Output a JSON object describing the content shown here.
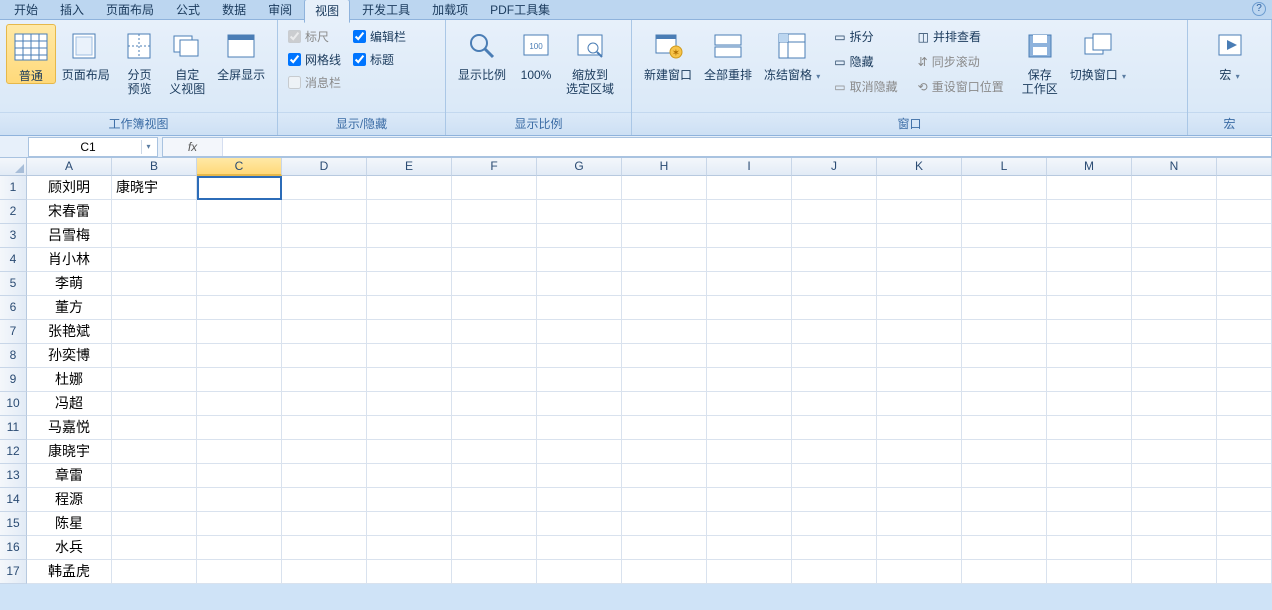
{
  "tabs": {
    "items": [
      "开始",
      "插入",
      "页面布局",
      "公式",
      "数据",
      "审阅",
      "视图",
      "开发工具",
      "加载项",
      "PDF工具集"
    ],
    "active": "视图"
  },
  "ribbon": {
    "groups": {
      "views": {
        "title": "工作簿视图",
        "normal": "普通",
        "page_layout": "页面布局",
        "page_break": "分页\n预览",
        "custom_views": "自定\n义视图",
        "full_screen": "全屏显示"
      },
      "show_hide": {
        "title": "显示/隐藏",
        "ruler": "标尺",
        "gridlines": "网格线",
        "message_bar": "消息栏",
        "formula_bar": "编辑栏",
        "headings": "标题"
      },
      "zoom": {
        "title": "显示比例",
        "zoom": "显示比例",
        "hundred": "100%",
        "to_selection": "缩放到\n选定区域"
      },
      "window": {
        "title": "窗口",
        "new_window": "新建窗口",
        "arrange_all": "全部重排",
        "freeze_panes": "冻结窗格",
        "split": "拆分",
        "hide": "隐藏",
        "unhide": "取消隐藏",
        "side_by_side": "并排查看",
        "sync_scroll": "同步滚动",
        "reset_pos": "重设窗口位置",
        "save_workspace": "保存\n工作区",
        "switch_windows": "切换窗口"
      },
      "macros": {
        "title": "宏",
        "macros": "宏"
      }
    }
  },
  "namebox": {
    "value": "C1"
  },
  "formula": {
    "label": "fx",
    "value": ""
  },
  "columns": [
    "A",
    "B",
    "C",
    "D",
    "E",
    "F",
    "G",
    "H",
    "I",
    "J",
    "K",
    "L",
    "M",
    "N"
  ],
  "selected_column": "C",
  "selected_cell": {
    "row": 1,
    "col": "C"
  },
  "row_count": 17,
  "cells": {
    "A": [
      "顾刘明",
      "宋春雷",
      "吕雪梅",
      "肖小林",
      "李萌",
      "董方",
      "张艳斌",
      "孙奕博",
      "杜娜",
      "冯超",
      "马嘉悦",
      "康晓宇",
      "章雷",
      "程源",
      "陈星",
      "水兵",
      "韩孟虎"
    ],
    "B": [
      "康晓宇"
    ]
  }
}
